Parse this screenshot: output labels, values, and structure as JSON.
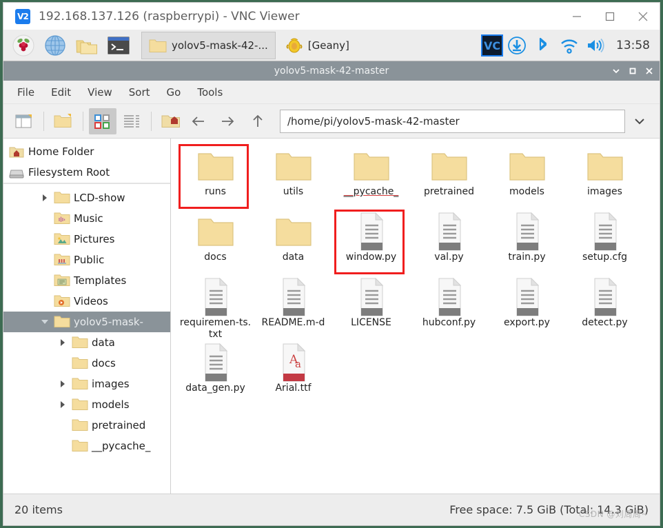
{
  "vnc": {
    "logo_text": "V2",
    "title": "192.168.137.126 (raspberrypi) - VNC Viewer",
    "minimize_label": "Minimize",
    "maximize_label": "Maximize",
    "close_label": "Close"
  },
  "taskbar": {
    "launchers": [
      {
        "name": "raspberry-menu-icon",
        "label": "Raspberry Pi Menu"
      },
      {
        "name": "web-browser-icon",
        "label": "Web Browser"
      },
      {
        "name": "file-manager-icon",
        "label": "File Manager"
      },
      {
        "name": "terminal-icon",
        "label": "Terminal"
      }
    ],
    "windows": [
      {
        "name": "task-file-manager",
        "label": "yolov5-mask-42-...",
        "icon": "folder-icon",
        "active": true
      },
      {
        "name": "task-geany",
        "label": "[Geany]",
        "icon": "geany-icon",
        "active": false
      }
    ],
    "tray": [
      {
        "name": "vnc-server-icon",
        "label": "VNC Server"
      },
      {
        "name": "updates-icon",
        "label": "Updates Available"
      },
      {
        "name": "bluetooth-icon",
        "label": "Bluetooth"
      },
      {
        "name": "wifi-icon",
        "label": "Wireless Network"
      },
      {
        "name": "volume-icon",
        "label": "Volume"
      }
    ],
    "clock": "13:58"
  },
  "filemanager": {
    "window_title": "yolov5-mask-42-master",
    "window_buttons": {
      "shade": "v",
      "maximize": "□",
      "close": "x"
    },
    "menus": [
      "File",
      "Edit",
      "View",
      "Sort",
      "Go",
      "Tools"
    ],
    "toolbar": {
      "new_tab_label": "New Tab",
      "new_folder_label": "New Folder",
      "icon_view_label": "Icon View",
      "detailed_view_label": "Detailed List View",
      "home_label": "Home",
      "back_label": "Back",
      "forward_label": "Forward",
      "up_label": "Up"
    },
    "path": "/home/pi/yolov5-mask-42-master",
    "path_dropdown_label": "Path history",
    "sidebar": {
      "places": [
        {
          "label": "Home Folder",
          "icon": "home-folder-icon"
        },
        {
          "label": "Filesystem Root",
          "icon": "drive-icon"
        }
      ],
      "tree": [
        {
          "label": "LCD-show",
          "icon": "folder-icon",
          "indent": 1,
          "expander": "collapsed",
          "selected": false
        },
        {
          "label": "Music",
          "icon": "music-folder-icon",
          "indent": 1,
          "expander": "none",
          "selected": false
        },
        {
          "label": "Pictures",
          "icon": "pictures-folder-icon",
          "indent": 1,
          "expander": "none",
          "selected": false
        },
        {
          "label": "Public",
          "icon": "public-folder-icon",
          "indent": 1,
          "expander": "none",
          "selected": false
        },
        {
          "label": "Templates",
          "icon": "templates-folder-icon",
          "indent": 1,
          "expander": "none",
          "selected": false
        },
        {
          "label": "Videos",
          "icon": "videos-folder-icon",
          "indent": 1,
          "expander": "none",
          "selected": false
        },
        {
          "label": "yolov5-mask-",
          "icon": "folder-icon",
          "indent": 1,
          "expander": "expanded",
          "selected": true
        },
        {
          "label": "data",
          "icon": "folder-icon",
          "indent": 2,
          "expander": "collapsed",
          "selected": false
        },
        {
          "label": "docs",
          "icon": "folder-icon",
          "indent": 2,
          "expander": "none",
          "selected": false
        },
        {
          "label": "images",
          "icon": "folder-icon",
          "indent": 2,
          "expander": "collapsed",
          "selected": false
        },
        {
          "label": "models",
          "icon": "folder-icon",
          "indent": 2,
          "expander": "collapsed",
          "selected": false
        },
        {
          "label": "pretrained",
          "icon": "folder-icon",
          "indent": 2,
          "expander": "none",
          "selected": false
        },
        {
          "label": "__pycache_",
          "icon": "folder-icon",
          "indent": 2,
          "expander": "none",
          "selected": false
        }
      ]
    },
    "files": [
      {
        "name": "runs",
        "type": "folder",
        "highlighted": true,
        "underlined": false
      },
      {
        "name": "utils",
        "type": "folder",
        "highlighted": false,
        "underlined": false
      },
      {
        "name": "__pycache_",
        "type": "folder",
        "highlighted": false,
        "underlined": true
      },
      {
        "name": "pretrained",
        "type": "folder",
        "highlighted": false,
        "underlined": false
      },
      {
        "name": "models",
        "type": "folder",
        "highlighted": false,
        "underlined": false
      },
      {
        "name": "images",
        "type": "folder",
        "highlighted": false,
        "underlined": false
      },
      {
        "name": "docs",
        "type": "folder",
        "highlighted": false,
        "underlined": false
      },
      {
        "name": "data",
        "type": "folder",
        "highlighted": false,
        "underlined": false
      },
      {
        "name": "window.py",
        "type": "document",
        "highlighted": true,
        "underlined": false
      },
      {
        "name": "val.py",
        "type": "document",
        "highlighted": false,
        "underlined": false
      },
      {
        "name": "train.py",
        "type": "document",
        "highlighted": false,
        "underlined": false
      },
      {
        "name": "setup.cfg",
        "type": "document",
        "highlighted": false,
        "underlined": false
      },
      {
        "name": "requiremen-ts.txt",
        "type": "document",
        "highlighted": false,
        "underlined": false
      },
      {
        "name": "README.m-d",
        "type": "document",
        "highlighted": false,
        "underlined": false
      },
      {
        "name": "LICENSE",
        "type": "document",
        "highlighted": false,
        "underlined": false
      },
      {
        "name": "hubconf.py",
        "type": "document",
        "highlighted": false,
        "underlined": false
      },
      {
        "name": "export.py",
        "type": "document",
        "highlighted": false,
        "underlined": false
      },
      {
        "name": "detect.py",
        "type": "document",
        "highlighted": false,
        "underlined": false
      },
      {
        "name": "data_gen.py",
        "type": "document",
        "highlighted": false,
        "underlined": false
      },
      {
        "name": "Arial.ttf",
        "type": "font",
        "highlighted": false,
        "underlined": false
      }
    ],
    "status": {
      "items": "20 items",
      "free_space": "Free space: 7.5 GiB (Total: 14.3 GiB)"
    }
  },
  "watermark": "CSDN @刘周周~",
  "colors": {
    "highlight": "#f01e1e",
    "titlebar": "#8a9399",
    "folder": "#f5dd9e",
    "accent_blue": "#1b7ced"
  }
}
